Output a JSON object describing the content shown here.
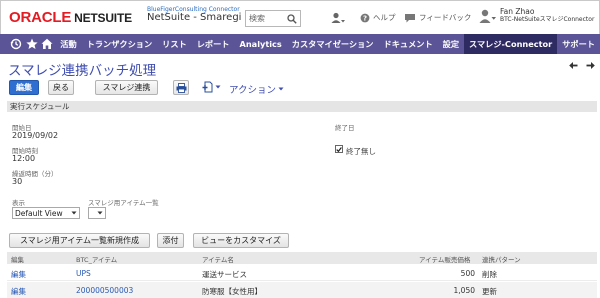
{
  "header": {
    "logo_oracle": "ORACLE",
    "logo_netsuite": "NETSUITE",
    "company_small": "BlueFigerConsulting Connector",
    "company_name": "NetSuite - Smaregi",
    "search_placeholder": "検索",
    "help_label": "ヘルプ",
    "feedback_label": "フィードバック",
    "user_name": "Fan Zhao",
    "user_role": "BTC-NetSuiteスマレジConnector"
  },
  "nav": {
    "items": [
      "活動",
      "トランザクション",
      "リスト",
      "レポート",
      "Analytics",
      "カスタマイゼーション",
      "ドキュメント",
      "設定",
      "スマレジ-Connector",
      "サポート"
    ],
    "active_index": 8,
    "bar_color": "#5b5598",
    "active_color": "#2e2a62"
  },
  "page": {
    "title": "スマレジ連携バッチ処理",
    "buttons": {
      "edit": "編集",
      "back": "戻る",
      "smaregi": "スマレジ連携"
    },
    "action_label": "アクション"
  },
  "section": {
    "title": "実行スケジュール"
  },
  "fields": {
    "start_date_label": "開始日",
    "start_date_value": "2019/09/02",
    "start_time_label": "開始時刻",
    "start_time_value": "12:00",
    "repeat_label": "繰返時間（分）",
    "repeat_value": "30",
    "end_date_label": "終了日",
    "no_end_label": "終了無し",
    "no_end_checked": true
  },
  "view": {
    "display_label": "表示",
    "display_value": "Default View",
    "item_list_label": "スマレジ用アイテム一覧",
    "item_list_value": ""
  },
  "sublist": {
    "buttons": {
      "new": "スマレジ用アイテム一覧新規作成",
      "attach": "添付",
      "customize": "ビューをカスタマイズ"
    },
    "columns": [
      "編集",
      "BTC_アイテム",
      "アイテム名",
      "アイテム販売価格",
      "連携パターン"
    ],
    "rows": [
      {
        "edit": "編集",
        "item": "UPS",
        "name": "運送サービス",
        "price": "500",
        "pattern": "削除"
      },
      {
        "edit": "編集",
        "item": "200000500003",
        "name": "防寒服【女性用】",
        "price": "1,050",
        "pattern": "更新"
      }
    ]
  }
}
